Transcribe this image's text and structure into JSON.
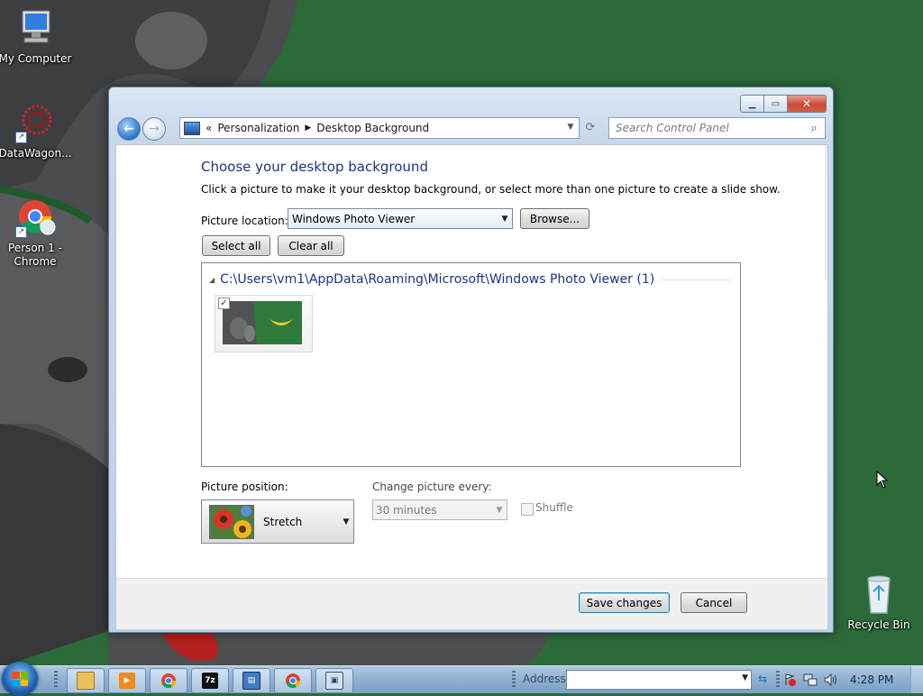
{
  "desktop": {
    "icons": [
      {
        "label": "My Computer"
      },
      {
        "label": "DataWagon..."
      },
      {
        "label": "Person 1 - Chrome"
      },
      {
        "label": "Recycle Bin"
      }
    ]
  },
  "window": {
    "breadcrumb": {
      "overflow": "«",
      "items": [
        "Personalization",
        "Desktop Background"
      ]
    },
    "search_placeholder": "Search Control Panel",
    "title": "Choose your desktop background",
    "description": "Click a picture to make it your desktop background, or select more than one picture to create a slide show.",
    "picture_location": {
      "label": "Picture location:",
      "value": "Windows Photo Viewer"
    },
    "browse_label": "Browse...",
    "select_all_label": "Select all",
    "clear_all_label": "Clear all",
    "group_header": "C:\\Users\\vm1\\AppData\\Roaming\\Microsoft\\Windows Photo Viewer (1)",
    "thumbnail_checked": true,
    "picture_position": {
      "label": "Picture position:",
      "value": "Stretch"
    },
    "change_picture": {
      "label": "Change picture every:",
      "value": "30 minutes",
      "enabled": false
    },
    "shuffle": {
      "label": "Shuffle",
      "checked": false,
      "enabled": false
    },
    "save_label": "Save changes",
    "cancel_label": "Cancel"
  },
  "taskbar": {
    "address_label": "Address",
    "address_value": "",
    "clock": "4:28 PM",
    "pinned": [
      "explorer-icon",
      "media-player-icon",
      "chrome-icon",
      "7zip-icon",
      "control-panel-icon",
      "chrome-profile-icon",
      "window-icon"
    ]
  },
  "colors": {
    "title_blue": "#1e3287",
    "desktop_green": "#2c6a3a",
    "close_red": "#c94a32"
  }
}
